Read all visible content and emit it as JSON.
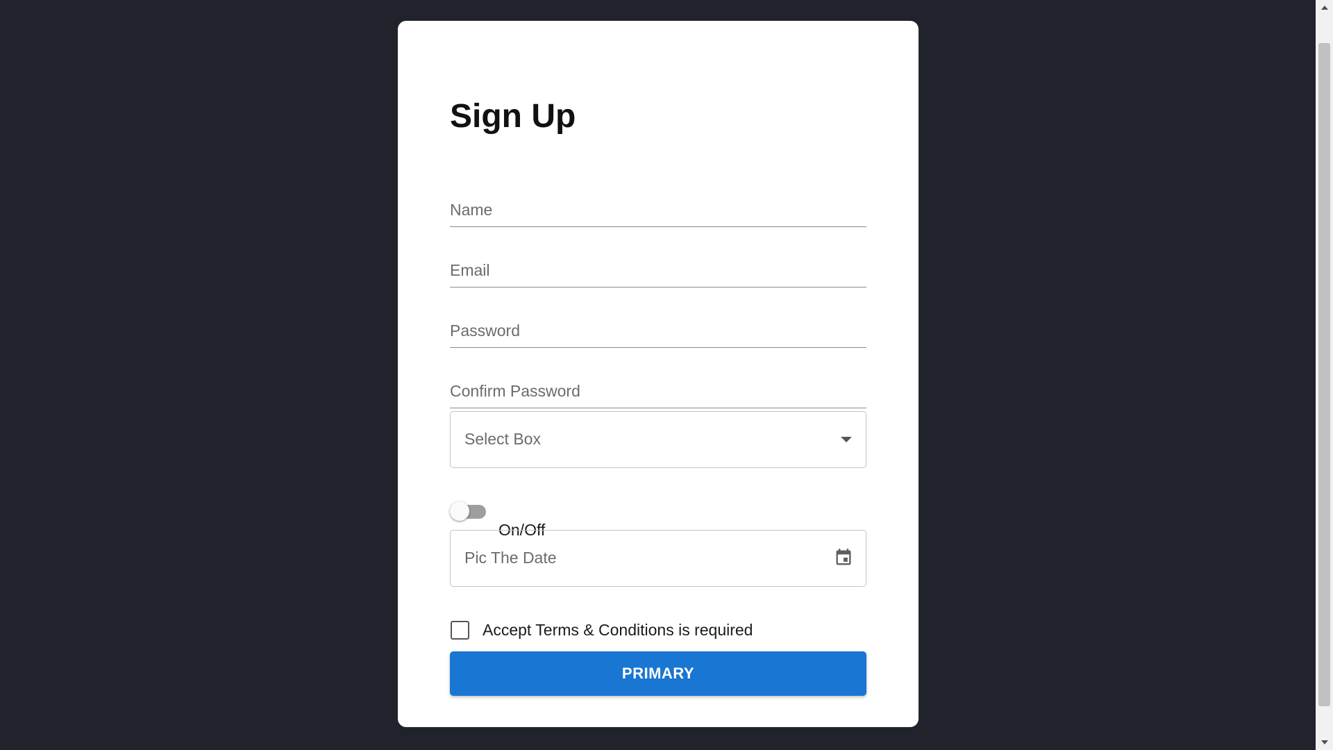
{
  "form": {
    "title": "Sign Up",
    "name_label": "Name",
    "email_label": "Email",
    "password_label": "Password",
    "confirm_password_label": "Confirm Password",
    "select_label": "Select Box",
    "toggle_label": "On/Off",
    "toggle_on": false,
    "date_label": "Pic The Date",
    "terms_label": "Accept Terms & Conditions is required",
    "terms_checked": false,
    "submit_label": "PRIMARY"
  },
  "colors": {
    "background": "#20232b",
    "card": "#ffffff",
    "primary": "#1976d2"
  },
  "icons": {
    "select": "chevron-down-icon",
    "date": "calendar-icon"
  }
}
